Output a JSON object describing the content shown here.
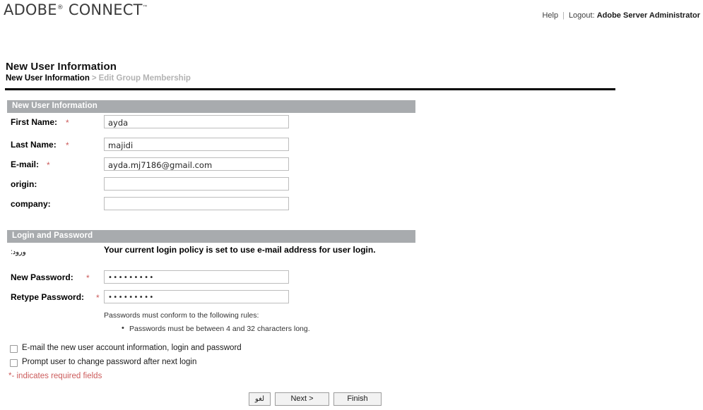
{
  "header": {
    "logo_primary": "ADOBE",
    "logo_registered": "®",
    "logo_secondary": "CONNECT",
    "logo_tm": "™",
    "help_label": "Help",
    "separator": "|",
    "logout_label": "Logout:",
    "user_name": "Adobe Server Administrator"
  },
  "page": {
    "title": "New User Information",
    "breadcrumb_current": "New User Information",
    "breadcrumb_separator": ">",
    "breadcrumb_next": "Edit Group Membership"
  },
  "user_section": {
    "heading": "New User Information",
    "fields": [
      {
        "label": "First Name:",
        "required": "*",
        "value": "ayda"
      },
      {
        "label": "Last Name:",
        "required": "*",
        "value": "majidi"
      },
      {
        "label": "E-mail:",
        "required": "*",
        "value": "ayda.mj7186@gmail.com"
      },
      {
        "label": "origin:",
        "required": "",
        "value": ""
      },
      {
        "label": "company:",
        "required": "",
        "value": ""
      }
    ]
  },
  "login_section": {
    "heading": "Login and Password",
    "login_label": "ورود:",
    "policy_note": "Your current login policy is set to use e-mail address for user login.",
    "password_fields": [
      {
        "label": "New Password:",
        "required": "*",
        "value": "•••••••••"
      },
      {
        "label": "Retype Password:",
        "required": "*",
        "value": "•••••••••"
      }
    ],
    "rules_intro": "Passwords must conform to the following rules:",
    "rules": [
      "Passwords must be between 4 and 32 characters long."
    ]
  },
  "options": {
    "email_account_info": "E-mail the new user account information, login and password",
    "prompt_change_password": "Prompt user to change password after next login",
    "required_note": "*- indicates required fields"
  },
  "buttons": {
    "cancel": "لغو",
    "next": "Next >",
    "finish": "Finish"
  },
  "colors": {
    "section_bar": "#a8abae",
    "required_red": "#cc5c5c",
    "rule_black": "#000000"
  }
}
